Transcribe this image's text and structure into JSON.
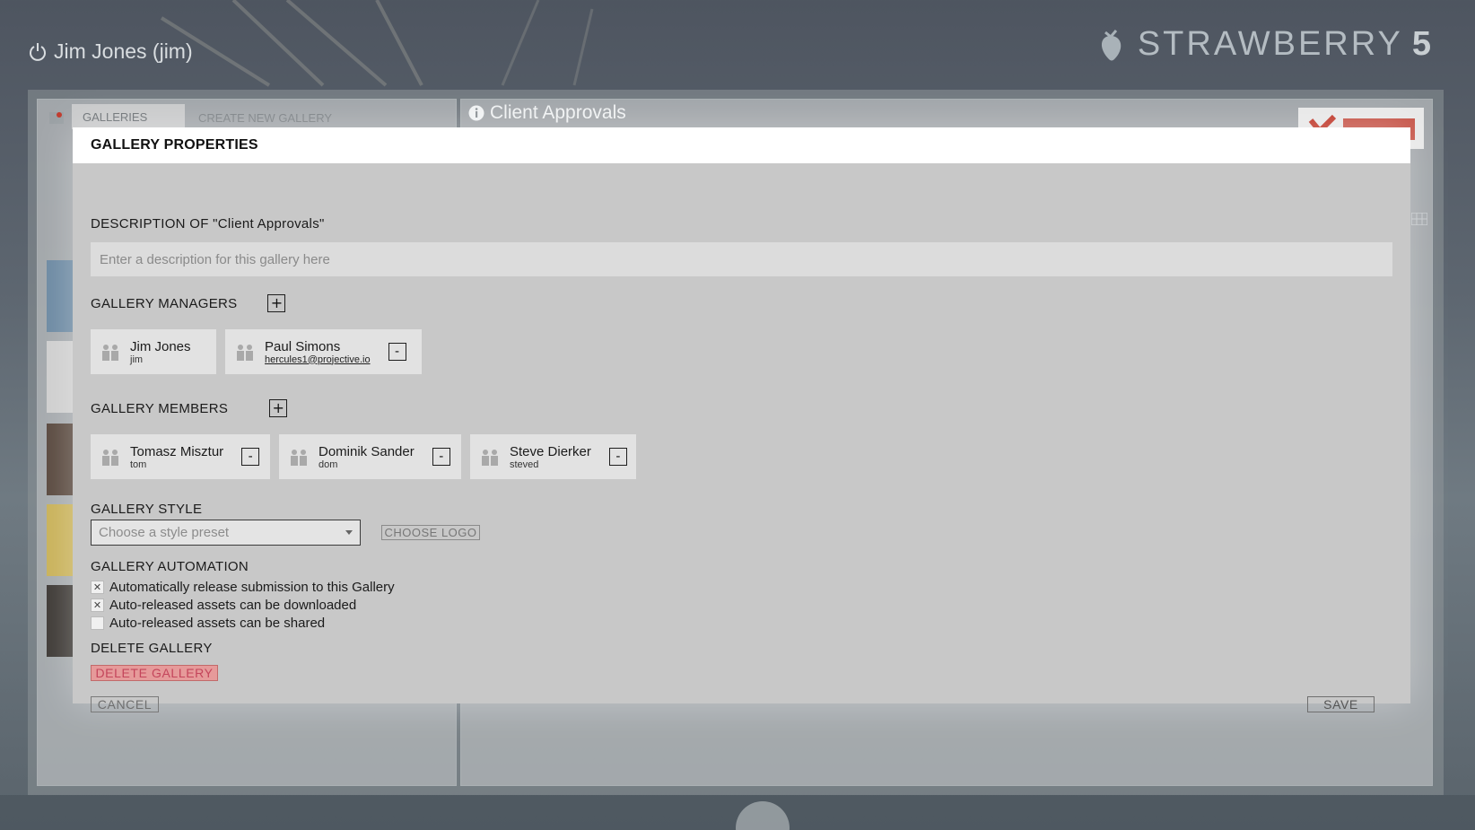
{
  "header": {
    "user_label": "Jim Jones (jim)",
    "brand_name": "STRAWBERRY",
    "brand_version": "5"
  },
  "left_panel": {
    "tabs": [
      {
        "label": "GALLERIES"
      },
      {
        "label": "CREATE NEW GALLERY"
      }
    ]
  },
  "right_panel": {
    "title": "Client Approvals"
  },
  "modal": {
    "title": "GALLERY PROPERTIES",
    "description_label": "DESCRIPTION OF \"Client Approvals\"",
    "description_value": "",
    "description_placeholder": "Enter a description for this gallery here",
    "managers_label": "GALLERY MANAGERS",
    "managers": [
      {
        "name": "Jim Jones",
        "sub": "jim",
        "removable": false
      },
      {
        "name": "Paul Simons",
        "sub": "hercules1@projective.io",
        "removable": true
      }
    ],
    "members_label": "GALLERY MEMBERS",
    "members": [
      {
        "name": "Tomasz Misztur",
        "sub": "tom"
      },
      {
        "name": "Dominik Sander",
        "sub": "dom"
      },
      {
        "name": "Steve Dierker",
        "sub": "steved"
      }
    ],
    "style_label": "GALLERY STYLE",
    "style_placeholder": "Choose a style preset",
    "choose_logo_label": "CHOOSE LOGO",
    "automation_label": "GALLERY AUTOMATION",
    "automation_options": [
      {
        "label": "Automatically release submission to this Gallery",
        "checked": true
      },
      {
        "label": "Auto-released assets can be downloaded",
        "checked": true
      },
      {
        "label": "Auto-released assets can be shared",
        "checked": false
      }
    ],
    "delete_label": "DELETE GALLERY",
    "delete_button": "DELETE GALLERY",
    "cancel_button": "CANCEL",
    "save_button": "SAVE",
    "plus_glyph": "+",
    "minus_glyph": "-",
    "check_glyph": "✕"
  },
  "colors": {
    "delete_bg": "#e69a9a",
    "delete_text": "#c4455b",
    "modal_bg": "#c8c8c8",
    "brand": "#b4bcc2"
  },
  "icons": {
    "power": "power-icon",
    "brand": "strawberry-icon",
    "info": "info-icon",
    "person": "people-icon",
    "plus": "plus-icon",
    "minus": "minus-icon",
    "caret": "chevron-down-icon"
  }
}
